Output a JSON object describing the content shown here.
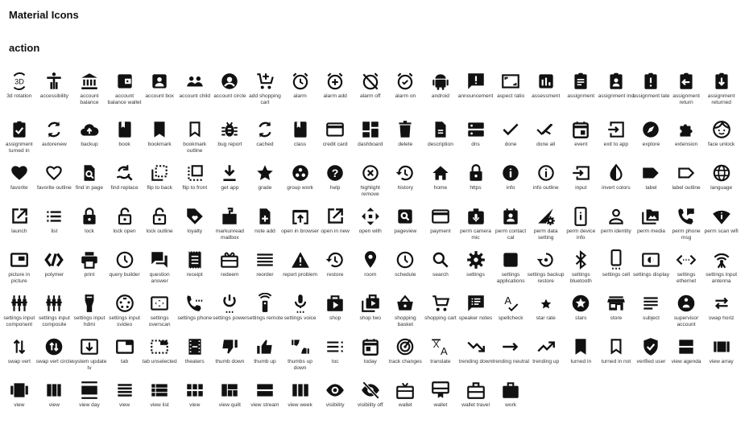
{
  "header": {
    "title": "Material Icons",
    "section": "action"
  },
  "rows": [
    [
      "3d rotation",
      "accessibility",
      "account balance",
      "account balance wallet",
      "account box",
      "account child",
      "account circle",
      "add shopping cart",
      "alarm",
      "alarm add",
      "alarm off",
      "alarm on",
      "android",
      "announcement",
      "aspect ratio",
      "assessment",
      "assignment",
      "assignment ind",
      "assignment late",
      "assignment return",
      "assignment returned"
    ],
    [
      "assignment turned in",
      "autorenew",
      "backup",
      "book",
      "bookmark",
      "bookmark outline",
      "bug report",
      "cached",
      "class",
      "credit card",
      "dashboard",
      "delete",
      "description",
      "dns",
      "done",
      "done all",
      "event",
      "exit to app",
      "explore",
      "extension",
      "face unlock"
    ],
    [
      "favorite",
      "favorite outline",
      "find in page",
      "find replace",
      "flip to back",
      "flip to front",
      "get app",
      "grade",
      "group work",
      "help",
      "highlight remove",
      "history",
      "home",
      "https",
      "info",
      "info outline",
      "input",
      "invert colors",
      "label",
      "label outline",
      "language"
    ],
    [
      "launch",
      "list",
      "lock",
      "lock open",
      "lock outline",
      "loyalty",
      "markunread mailbox",
      "note add",
      "open in browser",
      "open in new",
      "open with",
      "pageview",
      "payment",
      "perm camera mic",
      "perm contact cal",
      "perm data setting",
      "perm device info",
      "perm identity",
      "perm media",
      "perm phone msg",
      "perm scan wifi"
    ],
    [
      "picture in picture",
      "polymer",
      "print",
      "query builder",
      "question answer",
      "receipt",
      "redeem",
      "reorder",
      "report problem",
      "restore",
      "room",
      "schedule",
      "search",
      "settings",
      "settings applications",
      "settings backup restore",
      "settings bluetooth",
      "settings cell",
      "settings display",
      "settings ethernet",
      "settings input antenna"
    ],
    [
      "settings input component",
      "settings input composite",
      "settings input hdmi",
      "settings input svideo",
      "settings overscan",
      "settings phone",
      "settings power",
      "settings remote",
      "settings voice",
      "shop",
      "shop two",
      "shopping basket",
      "shopping cart",
      "speaker notes",
      "spellcheck",
      "star rate",
      "stars",
      "store",
      "subject",
      "supervisor account",
      "swap horiz"
    ],
    [
      "swap vert",
      "swap vert circle",
      "system update tv",
      "tab",
      "tab unselected",
      "theaters",
      "thumb down",
      "thumb up",
      "thumbs up down",
      "toc",
      "today",
      "track changes",
      "translate",
      "trending down",
      "trending neutral",
      "trending up",
      "turned in",
      "turned in not",
      "verified user",
      "view agenda",
      "view array"
    ],
    [
      "view",
      "view",
      "view day",
      "view",
      "view list",
      "view",
      "view quilt",
      "view stream",
      "view week",
      "visibility",
      "visibility off",
      "wallet",
      "wallet",
      "wallet travel",
      "work"
    ]
  ]
}
